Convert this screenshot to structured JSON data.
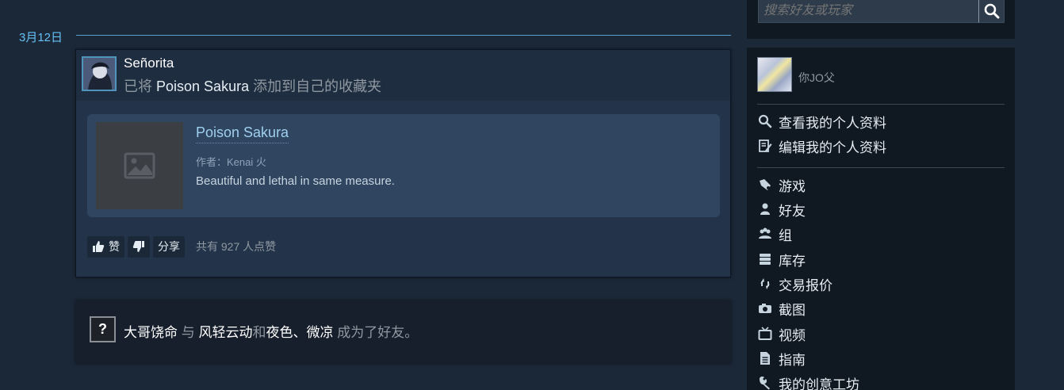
{
  "feed": {
    "date": "3月12日",
    "activity1": {
      "user": "Señorita",
      "action_prefix": "已将",
      "item_name": "Poison Sakura",
      "action_suffix": "添加到自己的收藏夹",
      "item": {
        "title": "Poison Sakura",
        "author": "作者：Kenai 火",
        "description": "Beautiful and lethal in same measure."
      },
      "buttons": {
        "like_label": "赞",
        "share_label": "分享"
      },
      "vote_count": "共有 927 人点赞"
    },
    "activity2": {
      "user_a": "大哥饶命",
      "conj1": "与",
      "user_b": "风轻云动",
      "conj2": "和",
      "user_c": "夜色、微凉",
      "suffix": "成为了好友。"
    }
  },
  "sidebar": {
    "search": {
      "placeholder": "搜索好友或玩家"
    },
    "profile": {
      "name": "你JO父"
    },
    "links": [
      {
        "label": "查看我的个人资料",
        "icon": "search-icon"
      },
      {
        "label": "编辑我的个人资料",
        "icon": "edit-icon"
      }
    ],
    "nav": [
      {
        "label": "游戏",
        "icon": "games-icon"
      },
      {
        "label": "好友",
        "icon": "friend-icon"
      },
      {
        "label": "组",
        "icon": "group-icon"
      },
      {
        "label": "库存",
        "icon": "inventory-icon"
      },
      {
        "label": "交易报价",
        "icon": "trade-icon"
      },
      {
        "label": "截图",
        "icon": "camera-icon"
      },
      {
        "label": "视频",
        "icon": "tv-icon"
      },
      {
        "label": "指南",
        "icon": "guide-icon"
      },
      {
        "label": "我的创意工坊",
        "icon": "wrench-icon"
      }
    ]
  },
  "colors": {
    "background": "#1b2838",
    "accent": "#66c0f4",
    "panel": "#101822"
  }
}
